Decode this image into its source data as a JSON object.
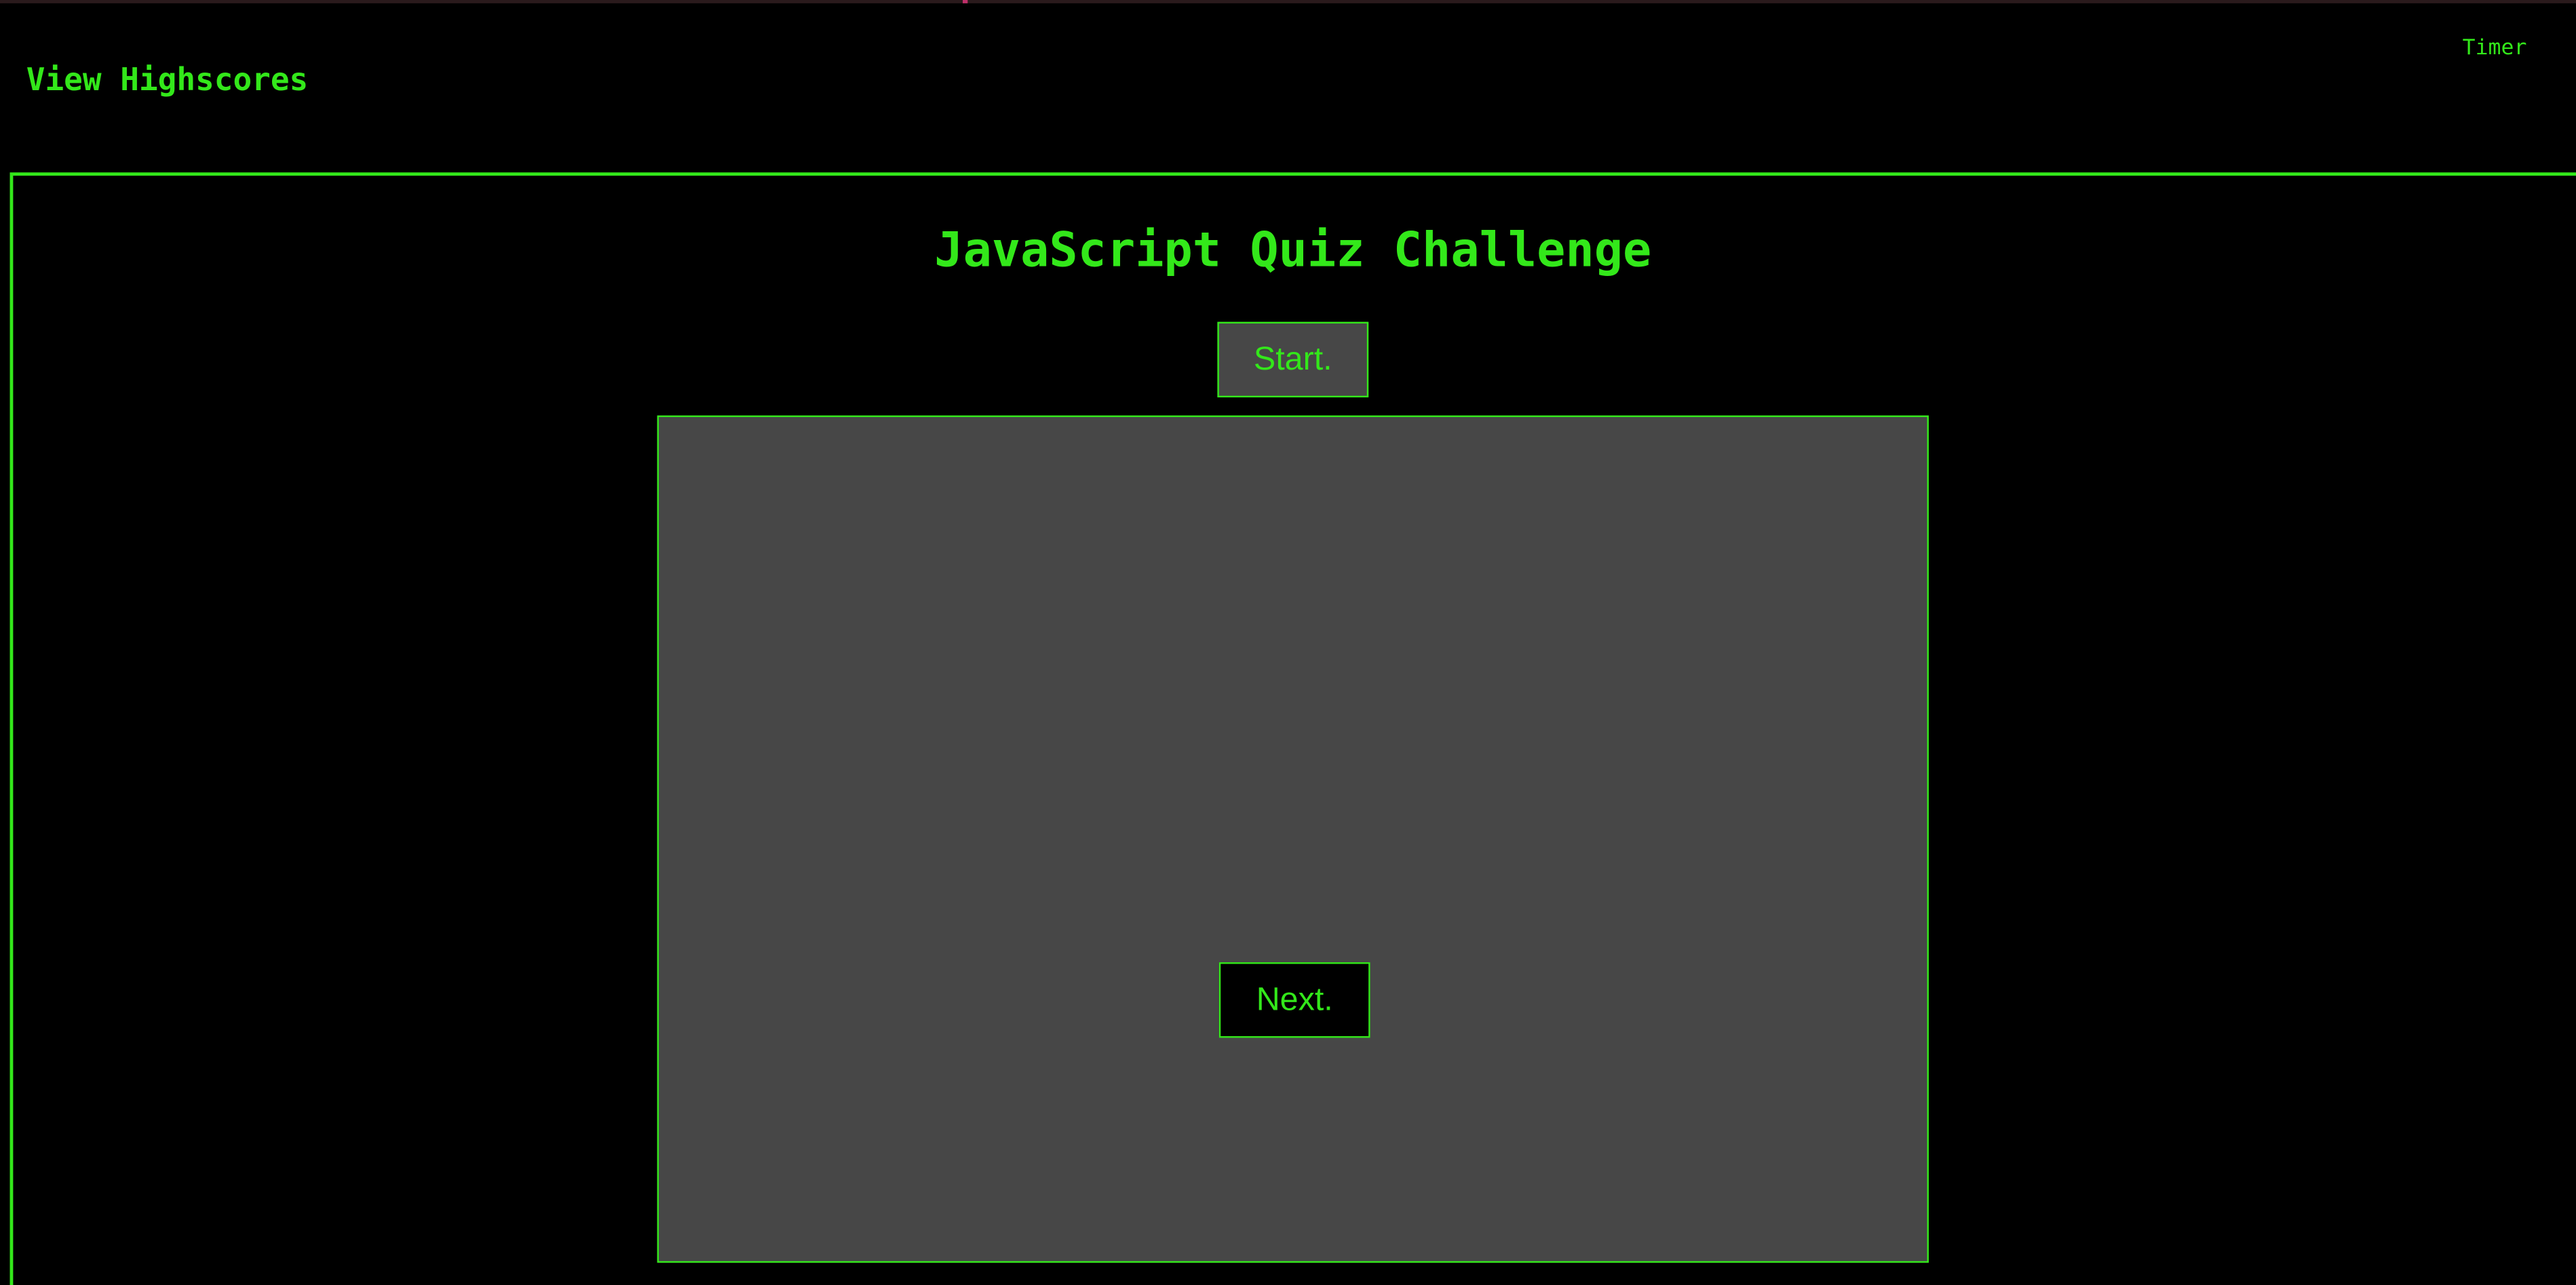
{
  "header": {
    "highscores_label": "View Highscores",
    "timer_label": "Timer"
  },
  "quiz": {
    "title": "JavaScript Quiz Challenge",
    "start_label": "Start.",
    "next_label": "Next."
  },
  "colors": {
    "background": "#000000",
    "accent_green": "#33e81a",
    "panel_gray": "#474747"
  }
}
